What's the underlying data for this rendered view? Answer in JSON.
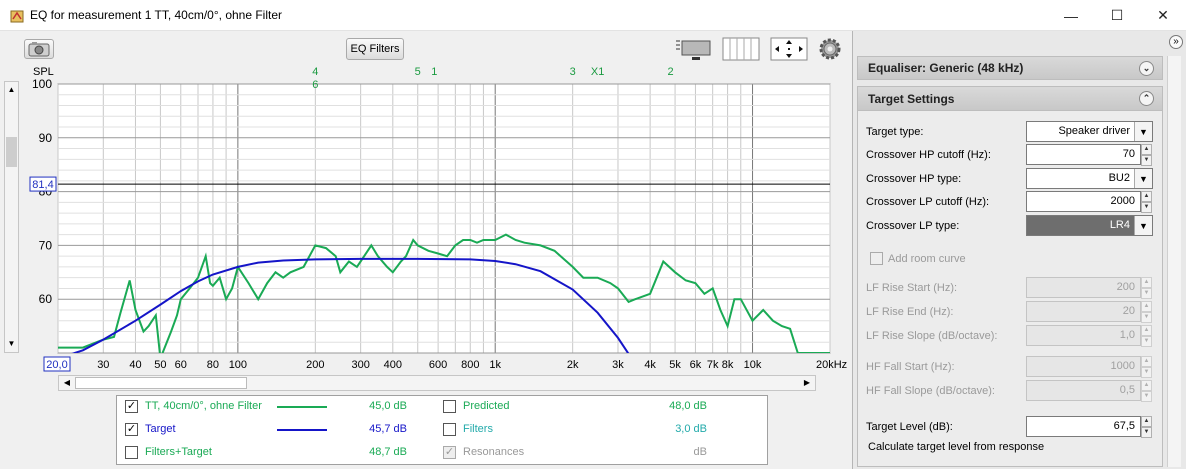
{
  "window": {
    "title": "EQ for measurement 1 TT, 40cm/0°, ohne Filter",
    "minimize": "—",
    "maximize": "☐",
    "close": "✕"
  },
  "toolbar": {
    "eq_filters_label": "EQ Filters",
    "icons": [
      "camera-icon",
      "layout-icon",
      "columns-icon",
      "move-arrows-icon",
      "gear-icon"
    ]
  },
  "chart_data": {
    "type": "line",
    "ylabel": "SPL",
    "xunit": "kHz",
    "y_ticks": [
      "100",
      "90",
      "80",
      "70",
      "60"
    ],
    "ylim": [
      50,
      100
    ],
    "xlim": [
      20,
      20000
    ],
    "x_scale": "log",
    "x_ticks": [
      "20,0",
      "30",
      "40",
      "50",
      "60",
      "80",
      "100",
      "200",
      "300",
      "400",
      "600",
      "800",
      "1k",
      "2k",
      "3k",
      "4k",
      "5k",
      "6k",
      "7k",
      "8k",
      "10k",
      "20kHz"
    ],
    "marker_line_value": "81,4",
    "marker_line_y": 81.4,
    "x_start_label": "20,0",
    "filter_markers": [
      {
        "label": "4",
        "freq": 200,
        "row": 0
      },
      {
        "label": "6",
        "freq": 200,
        "row": 1
      },
      {
        "label": "5",
        "freq": 500,
        "row": 0
      },
      {
        "label": "1",
        "freq": 580,
        "row": 0
      },
      {
        "label": "3",
        "freq": 2000,
        "row": 0
      },
      {
        "label": "X1",
        "freq": 2500,
        "row": 0
      },
      {
        "label": "2",
        "freq": 4800,
        "row": 0
      }
    ],
    "series": [
      {
        "name": "TT, 40cm/0°, ohne Filter",
        "color": "#1aaa55",
        "x": [
          20,
          25,
          30,
          33,
          35,
          38,
          40,
          43,
          45,
          48,
          50,
          55,
          58,
          60,
          65,
          70,
          75,
          78,
          80,
          85,
          90,
          95,
          100,
          110,
          120,
          130,
          140,
          150,
          160,
          180,
          200,
          220,
          240,
          250,
          270,
          290,
          300,
          330,
          350,
          380,
          400,
          430,
          450,
          480,
          500,
          550,
          600,
          650,
          700,
          750,
          800,
          850,
          900,
          950,
          1000,
          1100,
          1200,
          1300,
          1500,
          1700,
          2000,
          2200,
          2500,
          2800,
          3000,
          3300,
          3500,
          4000,
          4500,
          5000,
          5500,
          6000,
          6500,
          7000,
          7500,
          8000,
          8500,
          9000,
          10000,
          11000,
          12000,
          13000,
          14000,
          15000,
          16000,
          18000,
          20000
        ],
        "y": [
          51,
          51,
          52.5,
          53,
          57.5,
          63.5,
          58,
          54,
          55,
          57,
          49,
          54,
          57,
          60,
          62,
          64,
          68,
          63,
          62.5,
          64,
          60,
          62,
          66,
          63,
          60,
          63,
          65,
          64,
          65,
          66,
          70,
          69.5,
          68,
          65,
          67,
          66,
          67,
          70,
          68,
          66,
          65,
          67,
          68,
          71,
          70,
          69,
          68.5,
          68,
          70,
          71,
          71,
          70.5,
          71,
          71,
          71,
          72,
          71,
          70.5,
          70,
          69,
          66,
          64,
          64,
          63,
          62,
          59.5,
          60,
          61,
          67,
          65,
          63.5,
          63,
          61,
          62,
          58,
          55,
          60,
          60,
          56,
          58,
          56,
          55,
          54.5,
          50,
          50,
          50,
          50
        ]
      },
      {
        "name": "Target",
        "color": "#1515c8",
        "x": [
          20,
          25,
          30,
          40,
          50,
          60,
          70,
          80,
          100,
          120,
          150,
          200,
          300,
          500,
          800,
          1000,
          1200,
          1500,
          2000,
          2500,
          3000,
          3500,
          4000,
          5000
        ],
        "y": [
          49,
          50.5,
          52.5,
          56,
          59,
          61.5,
          63.3,
          64.6,
          66,
          66.8,
          67.2,
          67.4,
          67.5,
          67.5,
          67.4,
          67.1,
          66.5,
          65.2,
          61.8,
          57.5,
          52.8,
          48,
          43,
          35
        ]
      }
    ]
  },
  "legend": {
    "rows": [
      {
        "checked": true,
        "disabled": false,
        "label": "TT, 40cm/0°, ohne Filter",
        "value": "45,0 dB",
        "color": "#1aaa55"
      },
      {
        "checked": true,
        "disabled": false,
        "label": "Target",
        "value": "45,7 dB",
        "color": "#1515c8"
      },
      {
        "checked": false,
        "disabled": false,
        "label": "Filters+Target",
        "value": "48,7 dB",
        "color": "#1aaa55"
      }
    ],
    "rows_right": [
      {
        "checked": false,
        "disabled": false,
        "label": "Predicted",
        "value": "48,0 dB",
        "color": "#1aaa55"
      },
      {
        "checked": false,
        "disabled": false,
        "label": "Filters",
        "value": "3,0 dB",
        "color": "#22aaaa"
      },
      {
        "checked": true,
        "disabled": true,
        "label": "Resonances",
        "value": "dB",
        "color": "#999999"
      }
    ]
  },
  "panel": {
    "expand_arrows": "»",
    "equaliser_header": "Equaliser: Generic (48 kHz)",
    "target_header": "Target Settings",
    "target_type_label": "Target type:",
    "target_type_value": "Speaker driver",
    "hp_cutoff_label": "Crossover HP cutoff (Hz):",
    "hp_cutoff_value": "70",
    "hp_type_label": "Crossover HP type:",
    "hp_type_value": "BU2",
    "lp_cutoff_label": "Crossover LP cutoff (Hz):",
    "lp_cutoff_value": "2000",
    "lp_type_label": "Crossover LP type:",
    "lp_type_value": "LR4",
    "room_curve_label": "Add room curve",
    "lf_rise_start_label": "LF Rise Start (Hz):",
    "lf_rise_start_value": "200",
    "lf_rise_end_label": "LF Rise End (Hz):",
    "lf_rise_end_value": "20",
    "lf_rise_slope_label": "LF Rise Slope (dB/octave):",
    "lf_rise_slope_value": "1,0",
    "hf_fall_start_label": "HF Fall Start (Hz):",
    "hf_fall_start_value": "1000",
    "hf_fall_slope_label": "HF Fall Slope (dB/octave):",
    "hf_fall_slope_value": "0,5",
    "target_level_label": "Target Level (dB):",
    "target_level_value": "67,5",
    "calc_level_label": "Calculate target level from response"
  }
}
